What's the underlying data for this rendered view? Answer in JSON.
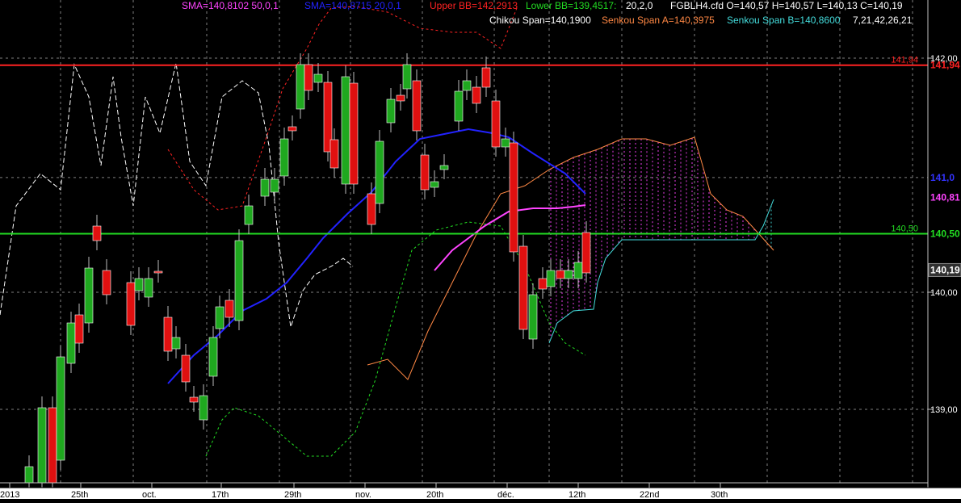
{
  "header": {
    "line1": [
      {
        "text": "SMA=140,8102  50,0,1",
        "color": "#ff44ff"
      },
      {
        "text": "SMA=140,8715  20,0,1",
        "color": "#2222ff"
      },
      {
        "text": "Upper BB=142,2913",
        "color": "#ff2222"
      },
      {
        "text": "Lower BB=139,4517:",
        "color": "#22dd22"
      },
      {
        "text": "20,2,0",
        "color": "#ffffff"
      },
      {
        "text": "FGBLH4.cfd O=140,57 H=140,57 L=140,13 C=140,19",
        "color": "#ffffff"
      }
    ],
    "line2": [
      {
        "text": "Chikou Span=140,1900",
        "color": "#ffffff"
      },
      {
        "text": "Senkou Span A=140,3975",
        "color": "#ff8844"
      },
      {
        "text": "Senkou Span B=140,8600",
        "color": "#44dddd"
      },
      {
        "text": "7,21,42,26,21",
        "color": "#ffffff"
      }
    ]
  },
  "price_axis": {
    "ticks": [
      "142,00",
      "140,00",
      "139,00"
    ],
    "tick_values": [
      142.0,
      140.0,
      139.0
    ],
    "labels": [
      {
        "text": "141,94",
        "value": 141.94,
        "color": "#ff2222"
      },
      {
        "text": "141,0",
        "value": 140.98,
        "color": "#3333ff"
      },
      {
        "text": "140,81",
        "value": 140.81,
        "color": "#ff44ff"
      },
      {
        "text": "140,50",
        "value": 140.5,
        "color": "#22dd22"
      },
      {
        "text": "140,19",
        "value": 140.19,
        "color": "#ffffff"
      }
    ]
  },
  "time_axis": {
    "labels": [
      {
        "text": "2013",
        "bar": 0
      },
      {
        "text": "25th",
        "bar": 4
      },
      {
        "text": "oct.",
        "bar": 8
      },
      {
        "text": "17th",
        "bar": 13
      },
      {
        "text": "29th",
        "bar": 17
      },
      {
        "text": "nov.",
        "bar": 21
      },
      {
        "text": "20th",
        "bar": 26
      },
      {
        "text": "déc.",
        "bar": 30
      },
      {
        "text": "12th",
        "bar": 34
      },
      {
        "text": "22nd",
        "bar": 38
      },
      {
        "text": "30th",
        "bar": 42
      }
    ]
  },
  "chart_data": {
    "type": "candlestick",
    "instrument": "FGBLH4.cfd",
    "ohlc_last": {
      "open": 140.57,
      "high": 140.57,
      "low": 140.13,
      "close": 140.19
    },
    "ylim": [
      138.3,
      142.6
    ],
    "horizontal_lines": [
      {
        "value": 141.94,
        "label": "141,94",
        "color": "#ff2222"
      },
      {
        "value": 140.5,
        "label": "140,50",
        "color": "#22dd22"
      }
    ],
    "candles": [
      {
        "i": 0,
        "o": 138.3,
        "h": 138.6,
        "l": 138.1,
        "c": 138.5
      },
      {
        "i": 1,
        "o": 138.4,
        "h": 139.0,
        "l": 138.2,
        "c": 138.9
      },
      {
        "i": 2,
        "o": 138.3,
        "h": 139.1,
        "l": 138.2,
        "c": 139.0
      },
      {
        "i": 3,
        "o": 138.5,
        "h": 139.5,
        "l": 138.4,
        "c": 139.3
      },
      {
        "i": 4,
        "o": 139.6,
        "h": 140.0,
        "l": 139.4,
        "c": 139.8
      },
      {
        "i": 5,
        "o": 139.6,
        "h": 140.3,
        "l": 139.5,
        "c": 139.9
      },
      {
        "i": 6,
        "o": 140.5,
        "h": 140.65,
        "l": 140.35,
        "c": 140.62
      },
      {
        "i": 7,
        "o": 140.2,
        "h": 140.3,
        "l": 140.0,
        "c": 140.1
      },
      {
        "i": 8,
        "o": 140.2,
        "h": 140.25,
        "l": 140.15,
        "c": 140.2
      },
      {
        "i": 9,
        "o": 140.1,
        "h": 140.5,
        "l": 139.7,
        "c": 139.75
      },
      {
        "i": 10,
        "o": 140.1,
        "h": 140.3,
        "l": 139.7,
        "c": 140.15
      },
      {
        "i": 11,
        "o": 140.2,
        "h": 140.25,
        "l": 140.0,
        "c": 140.05
      },
      {
        "i": 12,
        "o": 140.22,
        "h": 140.6,
        "l": 140.2,
        "c": 140.22
      },
      {
        "i": 13,
        "o": 139.8,
        "h": 139.9,
        "l": 139.3,
        "c": 139.5
      },
      {
        "i": 14,
        "o": 139.6,
        "h": 139.8,
        "l": 139.2,
        "c": 139.55
      },
      {
        "i": 15,
        "o": 139.4,
        "h": 139.6,
        "l": 139.0,
        "c": 139.2
      },
      {
        "i": 16,
        "o": 139.05,
        "h": 139.1,
        "l": 139.0,
        "c": 139.03
      },
      {
        "i": 17,
        "o": 138.9,
        "h": 139.1,
        "l": 138.7,
        "c": 139.1
      },
      {
        "i": 18,
        "o": 139.3,
        "h": 139.6,
        "l": 139.2,
        "c": 139.6
      },
      {
        "i": 19,
        "o": 139.8,
        "h": 140.1,
        "l": 139.7,
        "c": 140.05
      },
      {
        "i": 20,
        "o": 140.1,
        "h": 140.2,
        "l": 139.8,
        "c": 139.9
      },
      {
        "i": 21,
        "o": 139.9,
        "h": 140.5,
        "l": 139.85,
        "c": 140.5
      },
      {
        "i": 22,
        "o": 140.6,
        "h": 140.85,
        "l": 140.4,
        "c": 140.82
      },
      {
        "i": 23,
        "o": 140.8,
        "h": 140.8,
        "l": 140.7,
        "c": 140.75
      }
    ],
    "series": [
      {
        "name": "SMA 20",
        "color": "#2222ff"
      },
      {
        "name": "SMA 50",
        "color": "#ff44ff"
      },
      {
        "name": "Upper BB",
        "color": "#ff2222"
      },
      {
        "name": "Lower BB",
        "color": "#22dd22"
      },
      {
        "name": "Chikou Span",
        "color": "#ffffff"
      },
      {
        "name": "Senkou Span A",
        "color": "#ff8844"
      },
      {
        "name": "Senkou Span B",
        "color": "#44dddd"
      }
    ]
  }
}
